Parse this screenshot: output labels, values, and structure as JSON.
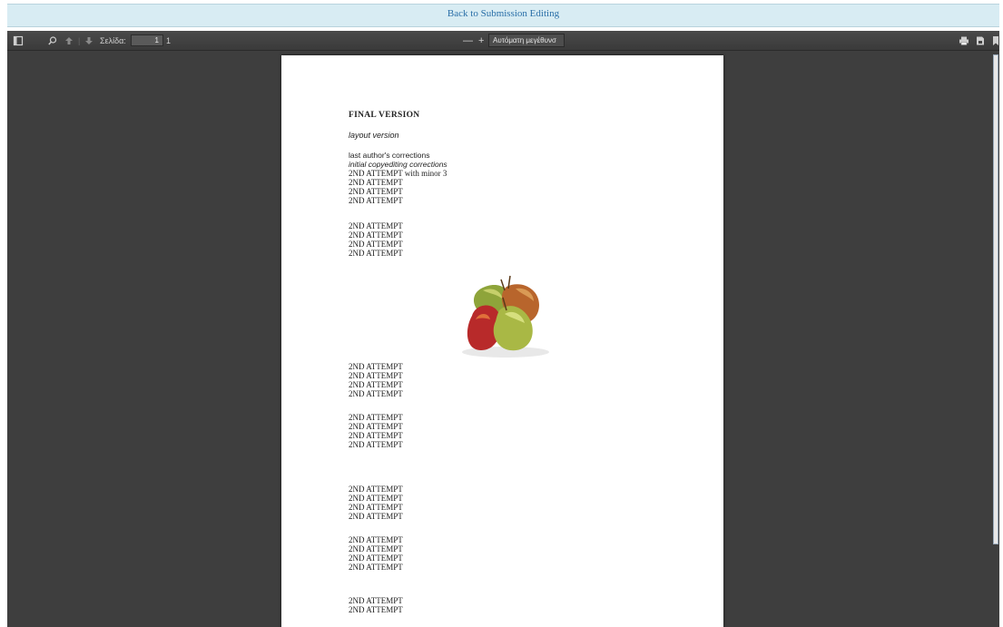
{
  "banner": {
    "link_label": "Back to Submission Editing"
  },
  "toolbar": {
    "page_label": "Σελίδα:",
    "page_number": "1",
    "page_total": "1",
    "zoom_value": "Αυτόματη μεγέθυνσ",
    "zoom_out": "—",
    "zoom_in": "+"
  },
  "document": {
    "title": "FINAL VERSION",
    "subtitle": "layout version",
    "line_corrections": "last author's corrections",
    "line_copyediting": "initial copyediting corrections",
    "line_minor": "2ND ATTEMPT with minor 3",
    "groups": [
      [
        "2ND ATTEMPT",
        "2ND ATTEMPT",
        "2ND ATTEMPT"
      ],
      [
        "2ND ATTEMPT",
        "2ND ATTEMPT",
        "2ND ATTEMPT",
        "2ND ATTEMPT"
      ],
      [
        "2ND ATTEMPT",
        "2ND ATTEMPT",
        "2ND ATTEMPT",
        "2ND ATTEMPT"
      ],
      [
        "2ND ATTEMPT",
        "2ND ATTEMPT",
        "2ND ATTEMPT",
        "2ND ATTEMPT"
      ],
      [
        "2ND ATTEMPT",
        "2ND ATTEMPT",
        "2ND ATTEMPT",
        "2ND ATTEMPT"
      ],
      [
        "2ND ATTEMPT",
        "2ND ATTEMPT",
        "2ND ATTEMPT",
        "2ND ATTEMPT"
      ],
      [
        "2ND ATTEMPT",
        "2ND ATTEMPT"
      ]
    ],
    "image": "pears-image"
  },
  "colors": {
    "banner_bg": "#d8ecf3",
    "link": "#2a6fa8",
    "viewer_bg": "#3e3e3e"
  }
}
